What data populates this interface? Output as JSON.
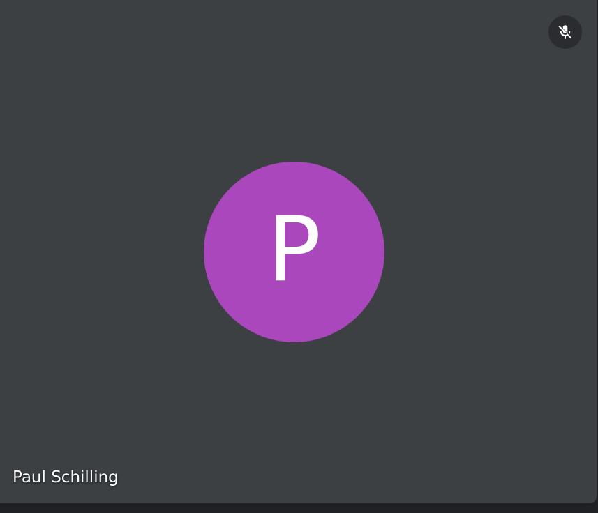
{
  "tile": {
    "participant_name": "Paul Schilling",
    "avatar_initial": "P",
    "avatar_color": "#ab47bc",
    "background_color": "#3c4043",
    "mute_indicator_icon": "mic-off-icon",
    "muted": true
  }
}
